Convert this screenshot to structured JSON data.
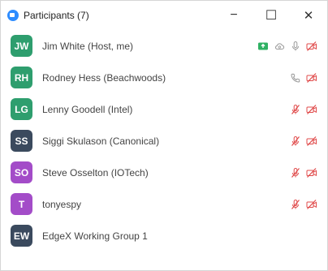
{
  "window": {
    "title": "Participants (7)",
    "minimize": "−",
    "maximize": "☐",
    "close": "✕"
  },
  "colors": {
    "host_green": "#2fb163",
    "muted_red": "#e04b4b",
    "gray_icon": "#9a9a9a",
    "accent_blue": "#2d8cff"
  },
  "participants": [
    {
      "initials": "JW",
      "name": "Jim White (Host, me)",
      "avatar_color": "#2e9e6e",
      "icons": [
        "screen-share-green-icon",
        "cloud-icon",
        "mic-icon",
        "video-off-icon"
      ]
    },
    {
      "initials": "RH",
      "name": "Rodney Hess (Beachwoods)",
      "avatar_color": "#2e9e6e",
      "icons": [
        "phone-icon",
        "video-off-icon"
      ]
    },
    {
      "initials": "LG",
      "name": "Lenny Goodell (Intel)",
      "avatar_color": "#2e9e6e",
      "icons": [
        "mic-muted-icon",
        "video-off-icon"
      ]
    },
    {
      "initials": "SS",
      "name": "Siggi Skulason (Canonical)",
      "avatar_color": "#3b4a5e",
      "icons": [
        "mic-muted-icon",
        "video-off-icon"
      ]
    },
    {
      "initials": "SO",
      "name": "Steve Osselton (IOTech)",
      "avatar_color": "#a34cc8",
      "icons": [
        "mic-muted-icon",
        "video-off-icon"
      ]
    },
    {
      "initials": "T",
      "name": "tonyespy",
      "avatar_color": "#a34cc8",
      "icons": [
        "mic-muted-icon",
        "video-off-icon"
      ]
    },
    {
      "initials": "EW",
      "name": "EdgeX Working Group 1",
      "avatar_color": "#3b4a5e",
      "icons": []
    }
  ]
}
